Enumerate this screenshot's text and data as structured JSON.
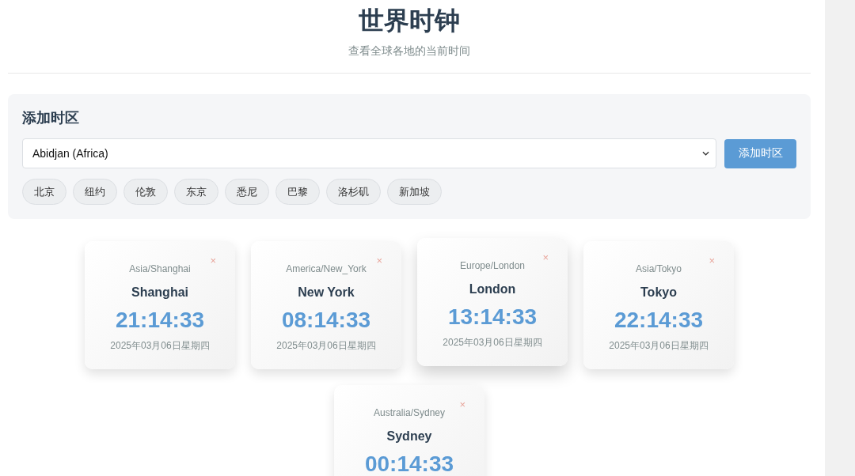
{
  "header": {
    "title": "世界时钟",
    "subtitle": "查看全球各地的当前时间"
  },
  "add_panel": {
    "heading": "添加时区",
    "select_value": "Abidjan (Africa)",
    "button": "添加时区",
    "quick_picks": [
      "北京",
      "纽约",
      "伦敦",
      "东京",
      "悉尼",
      "巴黎",
      "洛杉矶",
      "新加坡"
    ]
  },
  "clocks": [
    {
      "zone": "Asia/Shanghai",
      "city": "Shanghai",
      "time": "21:14:33",
      "date": "2025年03月06日星期四",
      "close": "×",
      "hovered": false
    },
    {
      "zone": "America/New_York",
      "city": "New York",
      "time": "08:14:33",
      "date": "2025年03月06日星期四",
      "close": "×",
      "hovered": false
    },
    {
      "zone": "Europe/London",
      "city": "London",
      "time": "13:14:33",
      "date": "2025年03月06日星期四",
      "close": "×",
      "hovered": true
    },
    {
      "zone": "Asia/Tokyo",
      "city": "Tokyo",
      "time": "22:14:33",
      "date": "2025年03月06日星期四",
      "close": "×",
      "hovered": false
    },
    {
      "zone": "Australia/Sydney",
      "city": "Sydney",
      "time": "00:14:33",
      "close": "×",
      "hovered": false
    }
  ]
}
